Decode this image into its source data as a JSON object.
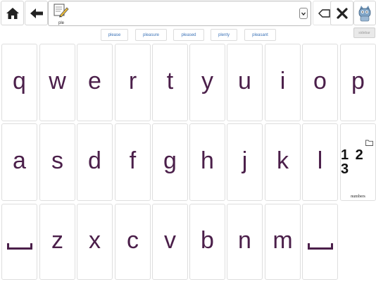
{
  "toolbar": {
    "home_icon": "home-icon",
    "back_icon": "arrow-left-icon",
    "backspace_icon": "backspace-icon",
    "clear_icon": "close-icon",
    "speak_icon": "app-avatar-icon"
  },
  "sentence": {
    "words": [
      {
        "label": "ple",
        "icon": "pencil-paper-icon"
      }
    ],
    "dropdown_icon": "chevron-down-icon"
  },
  "suggestions": [
    "please",
    "pleasure",
    "pleased",
    "plenty",
    "pleasant"
  ],
  "sidebar": {
    "label": "sidebar"
  },
  "keys": {
    "row1": [
      "q",
      "w",
      "e",
      "r",
      "t",
      "y",
      "u",
      "i",
      "o",
      "p"
    ],
    "row2": [
      "a",
      "s",
      "d",
      "f",
      "g",
      "h",
      "j",
      "k",
      "l"
    ],
    "row3": [
      "z",
      "x",
      "c",
      "v",
      "b",
      "n",
      "m"
    ]
  },
  "numbers_tile": {
    "glyph": "1 2 3",
    "caption": "numbers",
    "icon": "folder-icon"
  },
  "colors": {
    "key_text": "#4b1f4a",
    "link": "#3c73b7"
  }
}
